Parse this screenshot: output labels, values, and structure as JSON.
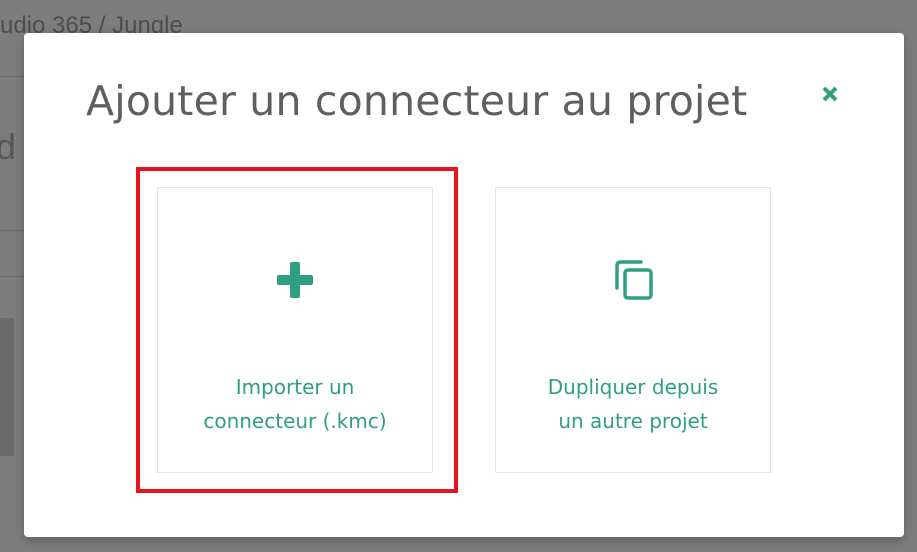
{
  "background": {
    "breadcrumb": "udio 365 / Jungle",
    "fragment_letter": "d"
  },
  "modal": {
    "title": "Ajouter un connecteur au projet",
    "close_icon": "close-icon",
    "options": [
      {
        "icon": "plus-icon",
        "label_line1": "Importer un",
        "label_line2": "connecteur (.kmc)",
        "highlighted": true
      },
      {
        "icon": "copy-icon",
        "label_line1": "Dupliquer depuis",
        "label_line2": "un autre projet",
        "highlighted": false
      }
    ]
  },
  "colors": {
    "accent": "#2f9f84",
    "highlight": "#e6141e",
    "title_text": "#5f5f5f",
    "overlay": "#7d7d7d"
  }
}
